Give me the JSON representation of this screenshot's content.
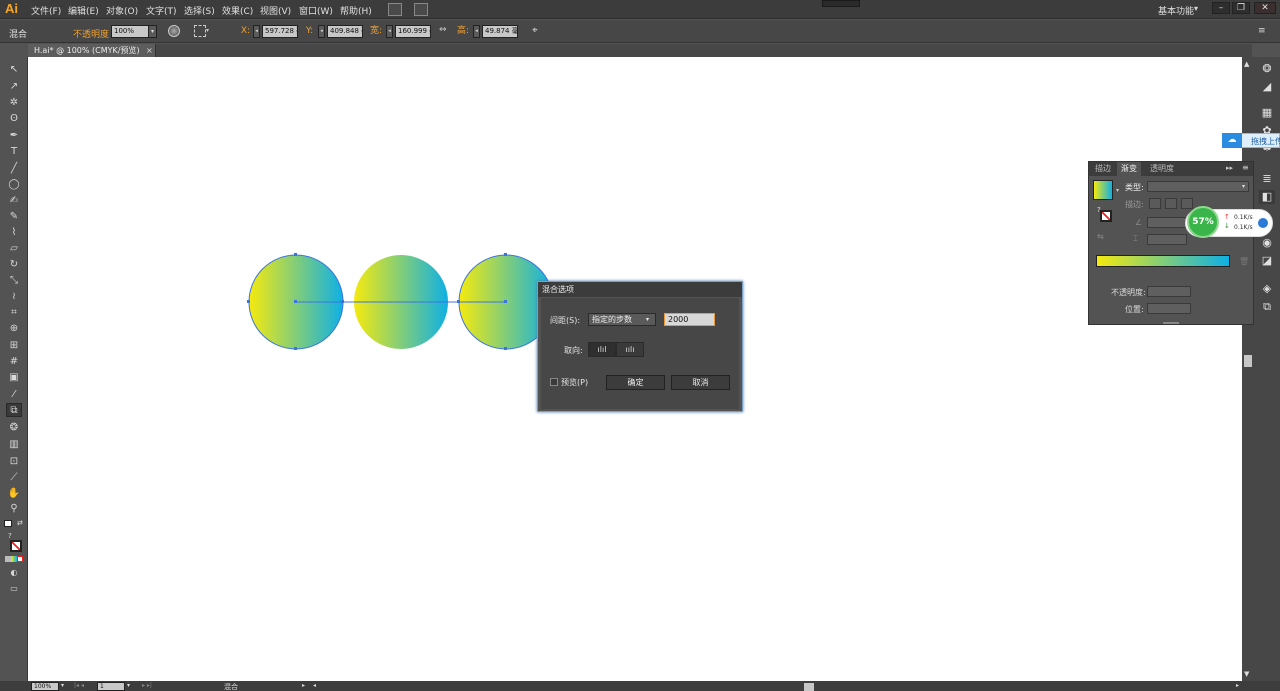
{
  "app": {
    "logo": "Ai"
  },
  "menu": {
    "items": [
      "文件(F)",
      "编辑(E)",
      "对象(O)",
      "文字(T)",
      "选择(S)",
      "效果(C)",
      "视图(V)",
      "窗口(W)",
      "帮助(H)"
    ]
  },
  "workspace": {
    "label": "基本功能",
    "dropdown_arrow": "▾"
  },
  "window_controls": {
    "minimize": "–",
    "restore": "❐",
    "close": "✕"
  },
  "controlbar": {
    "selection_label": "混合",
    "opacity_label": "不透明度",
    "opacity_value": "100%",
    "x_label": "X:",
    "x_value": "597.728 毫",
    "y_label": "Y:",
    "y_value": "409.848 毫",
    "w_label": "宽:",
    "w_value": "160.999 毫",
    "h_label": "高:",
    "h_value": "49.874 毫"
  },
  "document": {
    "tab_title": "H.ai* @ 100% (CMYK/预览)",
    "tab_close": "×"
  },
  "canvas_art": {
    "gradient_start": "#f5ea0e",
    "gradient_end": "#0eb0e5",
    "selection_color": "#3a74e0"
  },
  "blend_dialog": {
    "title": "混合选项",
    "spacing_label": "间距(S):",
    "spacing_option": "指定的步数",
    "steps_value": "2000",
    "orientation_label": "取向:",
    "preview_label": "预览(P)",
    "ok_label": "确定",
    "cancel_label": "取消"
  },
  "gradient_panel": {
    "tabs": [
      "描边",
      "渐变",
      "透明度"
    ],
    "active_tab": "渐变",
    "type_label": "类型:",
    "stroke_label": "描边:",
    "opacity_label": "不透明度:",
    "position_label": "位置:"
  },
  "net_widget": {
    "percent": "57%",
    "up_speed": "0.1K/s",
    "down_speed": "0.1K/s"
  },
  "upload": {
    "text": "拖拽上传"
  },
  "statusbar": {
    "zoom": "100%",
    "page": "1",
    "tool_name": "混合"
  }
}
